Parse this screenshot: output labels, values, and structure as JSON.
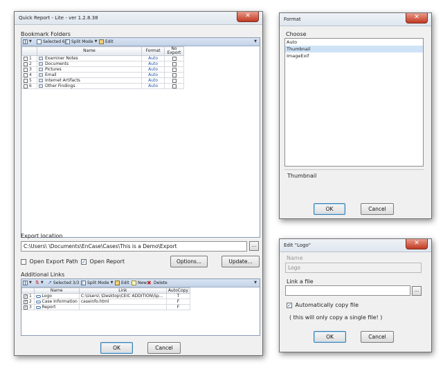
{
  "quick_report": {
    "title": "Quick Report - Lite  - ver 1.2.8.38",
    "bookmark_folders_label": "Bookmark Folders",
    "toolbar": {
      "selected": "Selected 6/6",
      "split_mode": "Split Mode",
      "edit": "Edit"
    },
    "columns": {
      "name": "Name",
      "format": "Format",
      "no_export": "No Export"
    },
    "rows": [
      {
        "num": "1",
        "name": "Examiner Notes",
        "format": "Auto"
      },
      {
        "num": "2",
        "name": "Documents",
        "format": "Auto"
      },
      {
        "num": "3",
        "name": "Pictures",
        "format": "Auto"
      },
      {
        "num": "4",
        "name": "Email",
        "format": "Auto"
      },
      {
        "num": "5",
        "name": "Internet Artifacts",
        "format": "Auto"
      },
      {
        "num": "6",
        "name": "Other Findings",
        "format": "Auto"
      }
    ],
    "export_location_label": "Export location",
    "export_path": "C:\\Users\\                    \\Documents\\EnCase\\Cases\\This is a Demo\\Export",
    "open_export_path": "Open Export Path",
    "open_report": "Open Report",
    "options_button": "Options...",
    "update_button": "Update...",
    "additional_links_label": "Additional Links",
    "links_toolbar": {
      "selected": "Selected 3/3",
      "split_mode": "Split Mode",
      "edit": "Edit",
      "new": "New",
      "delete": "Delete"
    },
    "links_columns": {
      "name": "Name",
      "link": "Link",
      "autocopy": "AutoCopy"
    },
    "links": [
      {
        "num": "1",
        "name": "Logo",
        "link": "C:\\Users\\                 \\Desktop\\CEIC ADDITION\\Sp...",
        "autocopy": "T"
      },
      {
        "num": "2",
        "name": "Case Information",
        "link": "caseinfo.html",
        "autocopy": "F"
      },
      {
        "num": "3",
        "name": "Report",
        "link": "",
        "autocopy": "F"
      }
    ],
    "ok_button": "OK",
    "cancel_button": "Cancel"
  },
  "format_dialog": {
    "title": "Format",
    "choose_label": "Choose",
    "options": [
      "Auto",
      "Thumbnail",
      "ImageExif"
    ],
    "selected_value": "Thumbnail",
    "ok_button": "OK",
    "cancel_button": "Cancel"
  },
  "edit_dialog": {
    "title": "Edit \"Logo\"",
    "name_label": "Name",
    "name_value": "Logo",
    "link_label": "Link a file",
    "link_value": "",
    "autocopy_label": "Automatically copy file",
    "note": "( this will only copy a single file! )",
    "ok_button": "OK",
    "cancel_button": "Cancel"
  },
  "colors": {
    "selection": "#cfe3f7",
    "grid_header": "#c3d3e8",
    "close_button": "#c23a22"
  }
}
